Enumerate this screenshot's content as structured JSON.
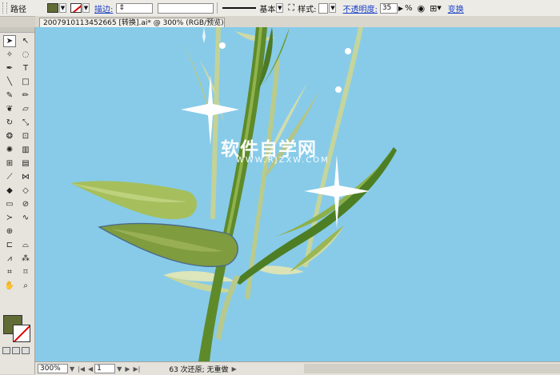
{
  "control_bar": {
    "object_label": "路径",
    "stroke_label": "描边:",
    "stroke_style": "基本",
    "style_label": "样式:",
    "opacity_label": "不透明度:",
    "opacity_value": "35",
    "opacity_unit": "%",
    "transform_label": "变换",
    "fill_color": "#616b35"
  },
  "document": {
    "tab_title": "2007910113452665 [转换].ai* @ 300% (RGB/预览)"
  },
  "canvas": {
    "background_color": "#87cbe9",
    "watermark_title": "软件自学网",
    "watermark_url": "WWW.RJZXW.COM"
  },
  "tools": [
    "selection-tool",
    "direct-selection-tool",
    "magic-wand-tool",
    "lasso-tool",
    "pen-tool",
    "type-tool",
    "line-segment-tool",
    "rectangle-tool",
    "paintbrush-tool",
    "pencil-tool",
    "blob-brush-tool",
    "eraser-tool",
    "rotate-tool",
    "scale-tool",
    "warp-tool",
    "free-transform-tool",
    "symbol-sprayer-tool",
    "column-graph-tool",
    "mesh-tool",
    "gradient-tool",
    "eyedropper-tool",
    "blend-tool",
    "live-paint-bucket-tool",
    "live-paint-selection-tool",
    "artboard-tool",
    "slice-tool",
    "width-tool",
    "reshape-tool",
    "perspective-grid-tool",
    "",
    "shape-builder-tool",
    "envelope-tool",
    "graph-tool",
    "symbol-tool",
    "crop-area-tool",
    "print-tiling-tool",
    "hand-tool",
    "zoom-tool"
  ],
  "status_bar": {
    "zoom": "300%",
    "page": "1",
    "message": "63 次还原; 无重做"
  }
}
